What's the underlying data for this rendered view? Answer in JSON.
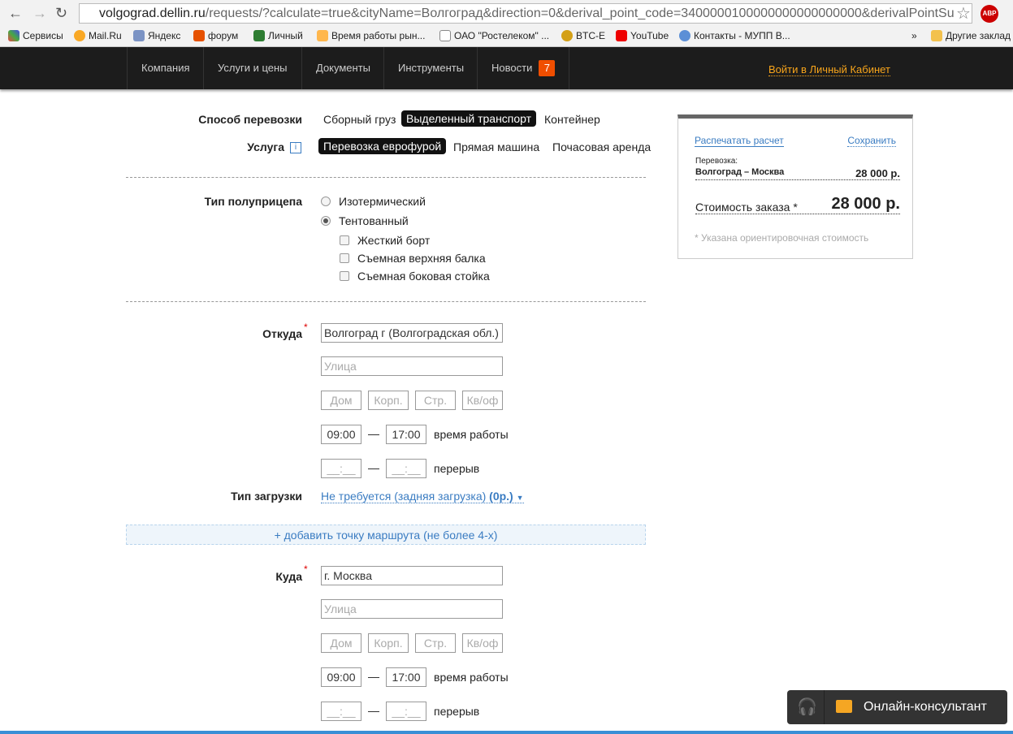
{
  "browser": {
    "url_host": "volgograd.dellin.ru",
    "url_rest": "/requests/?calculate=true&cityName=Волгоград&direction=0&derival_point_code=3400000100000000000000000&derivalPointSu",
    "bookmarks": [
      "Сервисы",
      "Mail.Ru",
      "Яндекс",
      "форум",
      "Личный",
      "Время работы рын...",
      "ОАО \"Ростелеком\" ...",
      "BTC-E",
      "YouTube",
      "Контакты - МУПП В..."
    ],
    "more": "»",
    "other": "Другие заклад",
    "abp": "ABP"
  },
  "nav": {
    "items": [
      "Компания",
      "Услуги и цены",
      "Документы",
      "Инструменты",
      "Новости"
    ],
    "news_count": "7",
    "login": "Войти в Личный Кабинет"
  },
  "form": {
    "transport_label": "Способ перевозки",
    "transport_options": [
      "Сборный груз",
      "Выделенный транспорт",
      "Контейнер"
    ],
    "service_label": "Услуга",
    "service_info": "i",
    "service_options": [
      "Перевозка еврофурой",
      "Прямая машина",
      "Почасовая аренда"
    ],
    "trailer_label": "Тип полуприцепа",
    "trailer_options": [
      "Изотермический",
      "Тентованный"
    ],
    "trailer_extras": [
      "Жесткий борт",
      "Съемная верхняя балка",
      "Съемная боковая стойка"
    ],
    "from": {
      "label": "Откуда",
      "city": "Волгоград г (Волгоградская обл.)",
      "street": "Улица",
      "house": "Дом",
      "block": "Корп.",
      "building": "Стр.",
      "flat": "Кв/оф",
      "work_from": "09:00",
      "work_to": "17:00",
      "work_label": "время работы",
      "break_from": "__:__",
      "break_to": "__:__",
      "break_label": "перерыв"
    },
    "loading_label": "Тип загрузки",
    "loading_value": "Не требуется (задняя загрузка)",
    "loading_price": "(0р.)",
    "add_point": "+ добавить точку маршрута (не более 4-х)",
    "to": {
      "label": "Куда",
      "city": "г. Москва",
      "street": "Улица",
      "house": "Дом",
      "block": "Корп.",
      "building": "Стр.",
      "flat": "Кв/оф",
      "work_from": "09:00",
      "work_to": "17:00",
      "work_label": "время работы",
      "break_from": "__:__",
      "break_to": "__:__",
      "break_label": "перерыв"
    },
    "dash": "—",
    "required": "*"
  },
  "summary": {
    "print": "Распечатать расчет",
    "save": "Сохранить",
    "item_label": "Перевозка:",
    "route": "Волгоград – Москва",
    "route_price": "28 000 р.",
    "total_label": "Стоимость заказа *",
    "total": "28 000 р.",
    "note": "* Указана ориентировочная стоимость"
  },
  "chat": {
    "label": "Онлайн-консультант"
  }
}
